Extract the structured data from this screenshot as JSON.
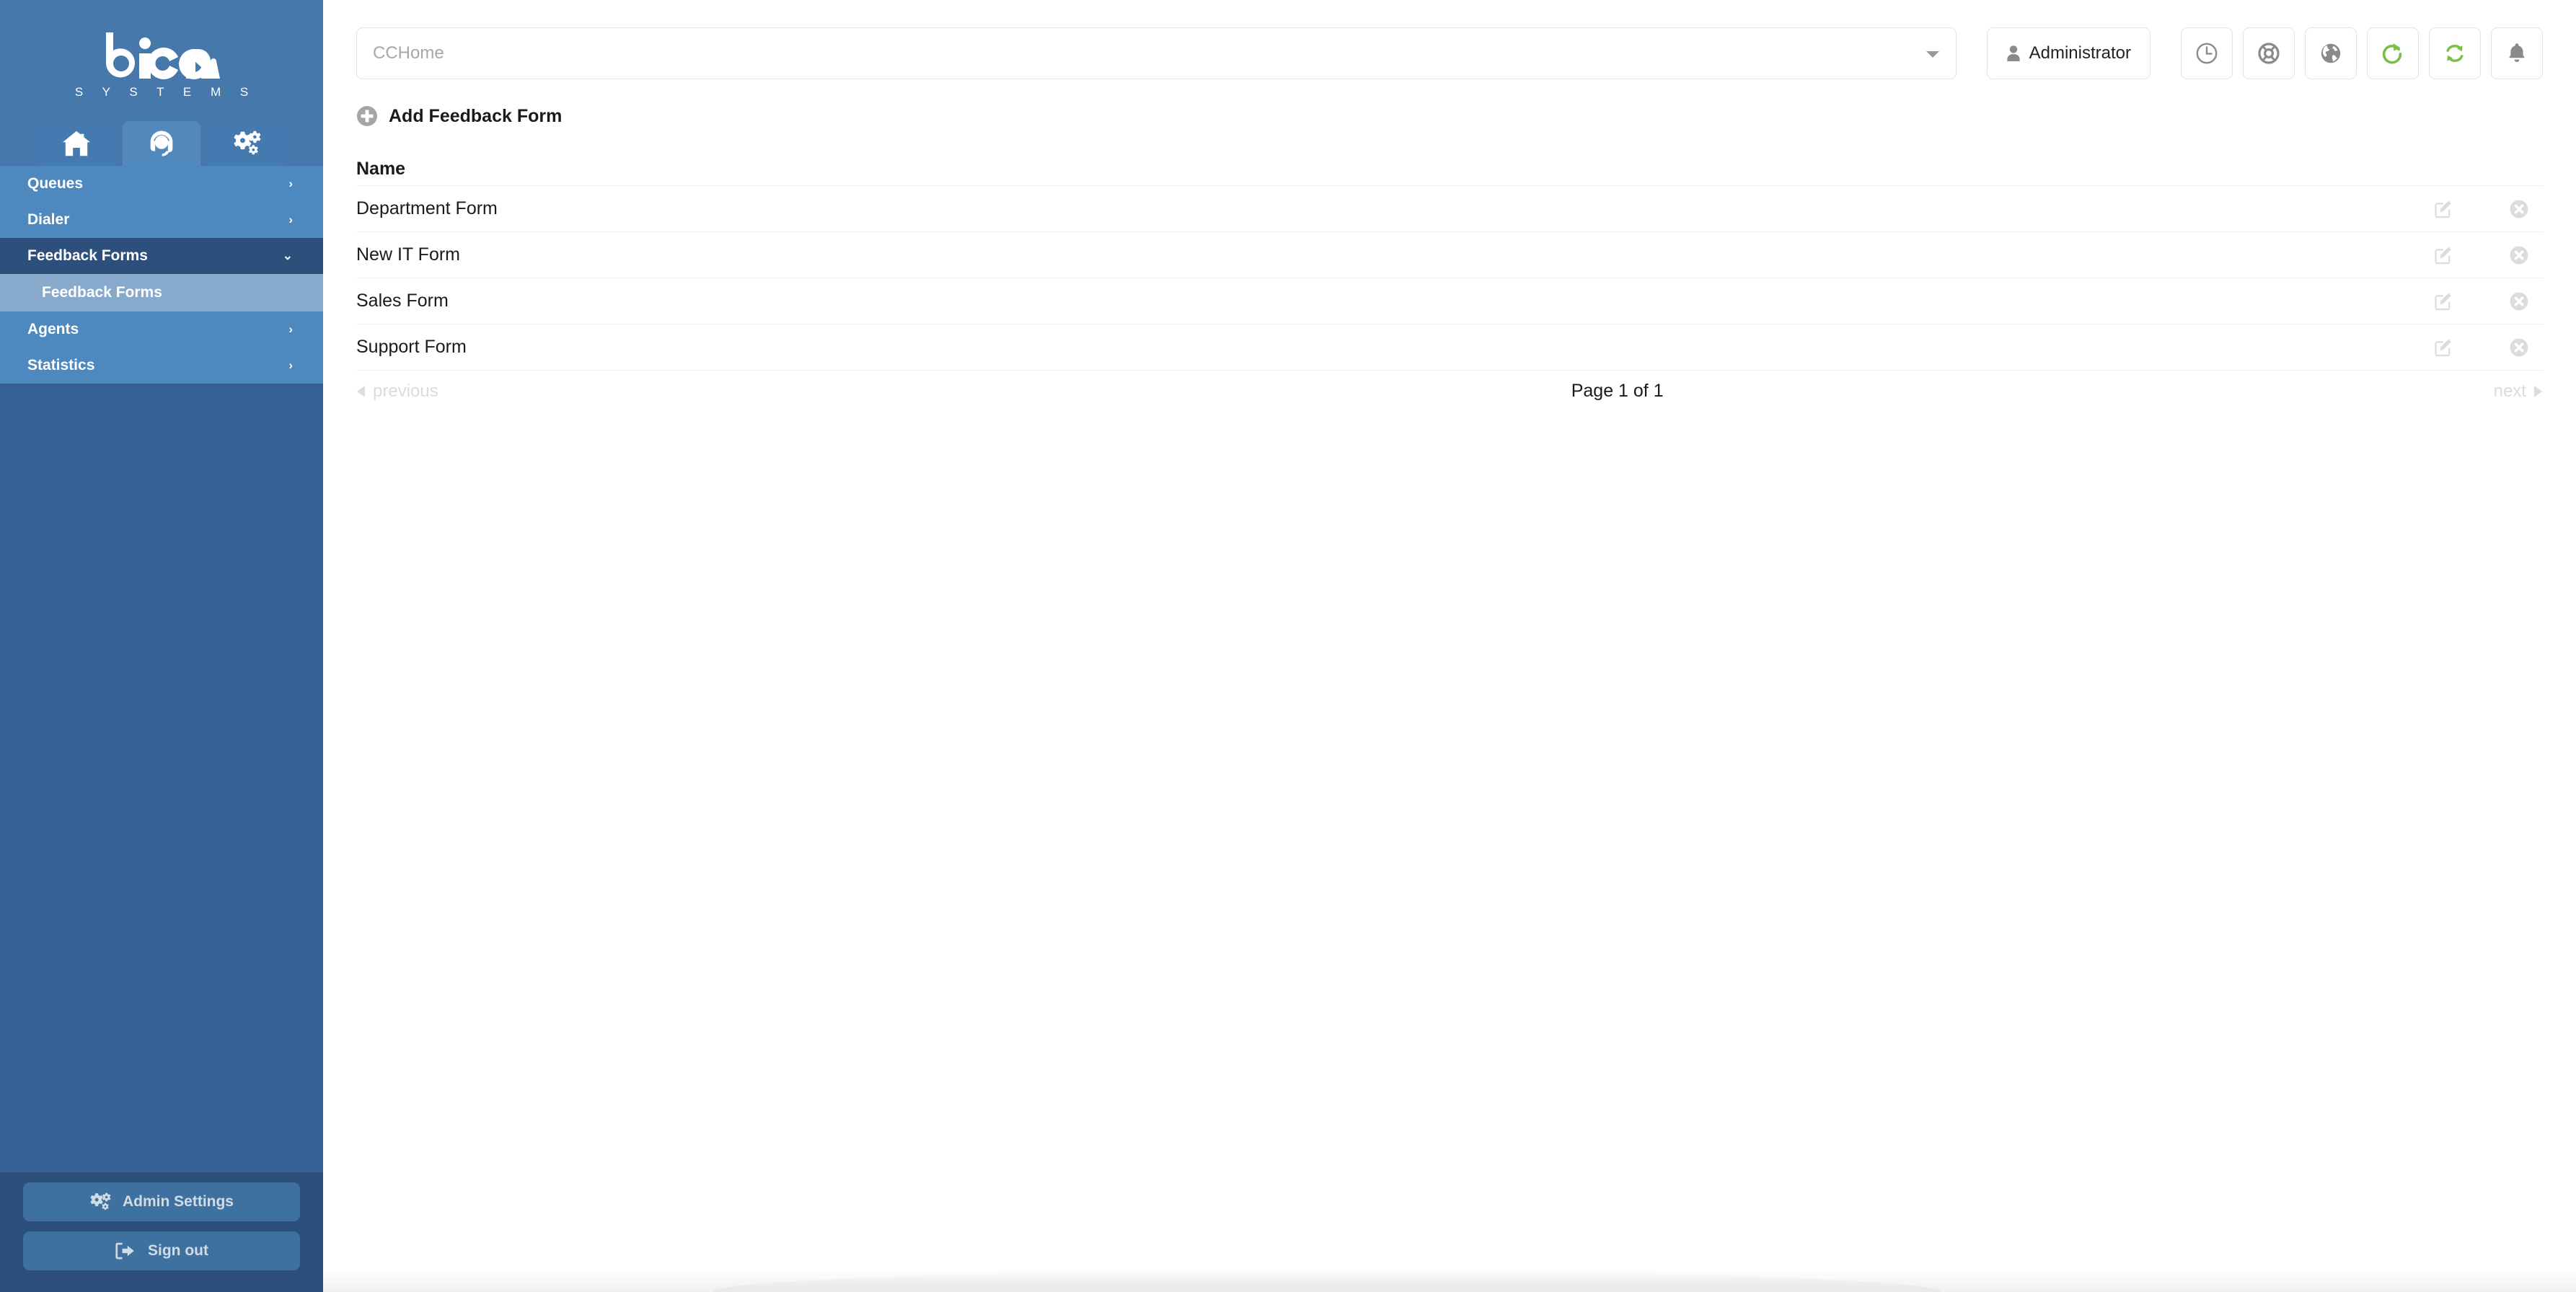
{
  "brand": {
    "name": "bicom",
    "subtitle": "S Y S T E M S"
  },
  "sidebar": {
    "tabs": [
      {
        "icon": "home-icon",
        "active": false
      },
      {
        "icon": "headset-icon",
        "active": true
      },
      {
        "icon": "gears-icon",
        "active": false
      }
    ],
    "items": [
      {
        "label": "Queues",
        "chevron": "›",
        "state": "collapsed"
      },
      {
        "label": "Dialer",
        "chevron": "›",
        "state": "collapsed"
      },
      {
        "label": "Feedback Forms",
        "chevron": "⌄",
        "state": "expanded"
      },
      {
        "label": "Agents",
        "chevron": "›",
        "state": "collapsed"
      },
      {
        "label": "Statistics",
        "chevron": "›",
        "state": "collapsed"
      }
    ],
    "subitem": {
      "label": "Feedback Forms",
      "selected": true
    },
    "admin_settings_label": "Admin Settings",
    "sign_out_label": "Sign out"
  },
  "topbar": {
    "select_value": "CCHome",
    "select_placeholder": "CCHome",
    "user_label": "Administrator",
    "icon_buttons": [
      {
        "name": "clock-icon",
        "color": "#8a8a8a"
      },
      {
        "name": "life-ring-icon",
        "color": "#8a8a8a"
      },
      {
        "name": "globe-icon",
        "color": "#8a8a8a"
      },
      {
        "name": "reload-icon",
        "color": "#78c043"
      },
      {
        "name": "sync-icon",
        "color": "#78c043"
      },
      {
        "name": "bell-icon",
        "color": "#8a8a8a"
      }
    ]
  },
  "main": {
    "add_button_label": "Add Feedback Form",
    "table": {
      "columns": [
        "Name"
      ],
      "rows": [
        {
          "name": "Department Form",
          "edit": "edit-icon",
          "delete": "delete-icon"
        },
        {
          "name": "New IT Form",
          "edit": "edit-icon",
          "delete": "delete-icon"
        },
        {
          "name": "Sales Form",
          "edit": "edit-icon",
          "delete": "delete-icon"
        },
        {
          "name": "Support Form",
          "edit": "edit-icon",
          "delete": "delete-icon"
        }
      ]
    },
    "pagination": {
      "previous_label": "previous",
      "page_label": "Page 1 of 1",
      "next_label": "next"
    }
  },
  "colors": {
    "sidebar_top": "#4678ab",
    "sidebar_nav": "#4d88bf",
    "sidebar_active": "#2c4f7c",
    "sidebar_subitem": "#87a9cc",
    "sidebar_body": "#356094",
    "accent_green": "#78c043",
    "text_muted": "#a8a8a8"
  }
}
